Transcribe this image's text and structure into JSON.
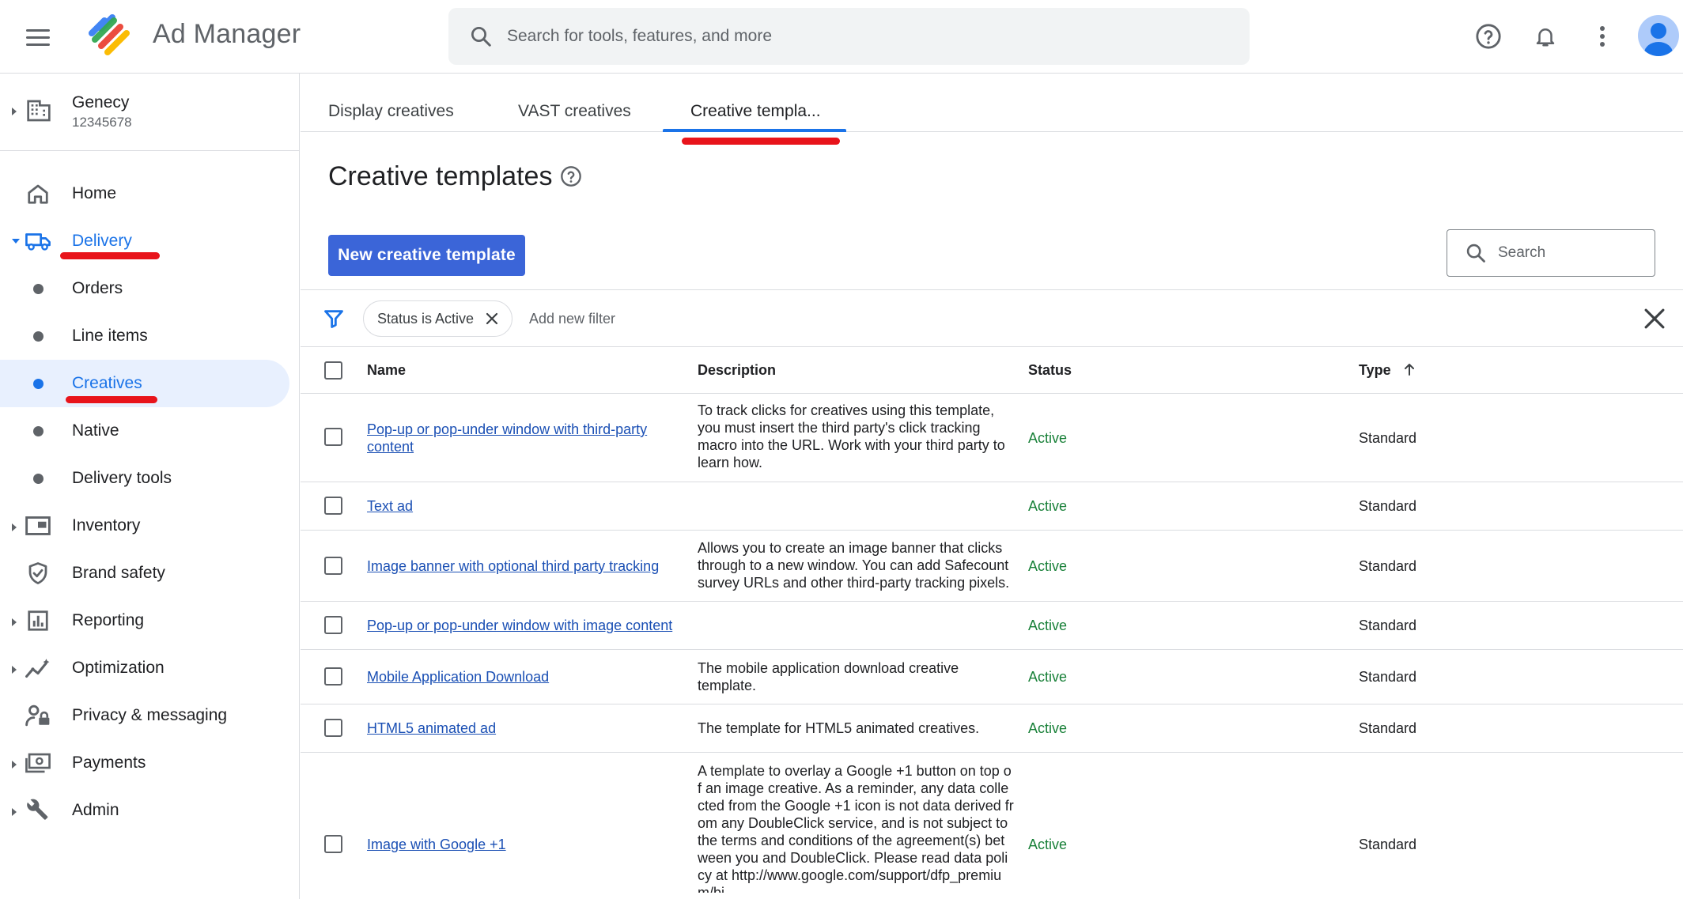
{
  "app": {
    "title": "Ad Manager",
    "search_placeholder": "Search for tools, features, and more",
    "accent_color": "#1a73e8",
    "annotation_color": "#e8141b"
  },
  "network": {
    "name": "Genecy",
    "id": "12345678"
  },
  "sidebar": {
    "items": [
      {
        "label": "Home",
        "icon": "home-icon"
      },
      {
        "label": "Delivery",
        "icon": "truck-icon",
        "expanded": true
      },
      {
        "label": "Orders"
      },
      {
        "label": "Line items"
      },
      {
        "label": "Creatives",
        "selected": true
      },
      {
        "label": "Native"
      },
      {
        "label": "Delivery tools"
      },
      {
        "label": "Inventory",
        "icon": "inventory-icon"
      },
      {
        "label": "Brand safety",
        "icon": "shield-icon"
      },
      {
        "label": "Reporting",
        "icon": "reporting-icon"
      },
      {
        "label": "Optimization",
        "icon": "optimization-icon"
      },
      {
        "label": "Privacy & messaging",
        "icon": "privacy-icon"
      },
      {
        "label": "Payments",
        "icon": "payments-icon"
      },
      {
        "label": "Admin",
        "icon": "wrench-icon"
      }
    ]
  },
  "tabs": [
    {
      "label": "Display creatives"
    },
    {
      "label": "VAST creatives"
    },
    {
      "label": "Creative templa...",
      "active": true
    }
  ],
  "page": {
    "title": "Creative templates",
    "new_button": "New creative template",
    "search_label": "Search"
  },
  "filters": {
    "chip": "Status is Active",
    "add_filter": "Add new filter"
  },
  "table": {
    "headers": {
      "name": "Name",
      "description": "Description",
      "status": "Status",
      "type": "Type"
    },
    "rows": [
      {
        "name": "Pop-up or pop-under window with third-party content",
        "description": "To track clicks for creatives using this template, you must insert the third party's click tracking macro into the URL. Work with your third party to learn how.",
        "status": "Active",
        "type": "Standard"
      },
      {
        "name": "Text ad",
        "description": "",
        "status": "Active",
        "type": "Standard"
      },
      {
        "name": "Image banner with optional third party tracking",
        "description": "Allows you to create an image banner that clicks through to a new window. You can add Safecount survey URLs and other third-party tracking pixels.",
        "status": "Active",
        "type": "Standard"
      },
      {
        "name": "Pop-up or pop-under window with image content",
        "description": "",
        "status": "Active",
        "type": "Standard"
      },
      {
        "name": "Mobile Application Download",
        "description": "The mobile application download creative template.",
        "status": "Active",
        "type": "Standard"
      },
      {
        "name": "HTML5 animated ad",
        "description": "The template for HTML5 animated creatives.",
        "status": "Active",
        "type": "Standard"
      },
      {
        "name": "Image with Google +1",
        "description": "A template to overlay a Google +1 button on top of an image creative. As a reminder, any data collected from the Google +1 icon is not data derived from any DoubleClick service, and is not subject to the terms and conditions of the agreement(s) between you and DoubleClick. Please read data policy at http://www.google.com/support/dfp_premium/bi",
        "status": "Active",
        "type": "Standard"
      }
    ]
  }
}
